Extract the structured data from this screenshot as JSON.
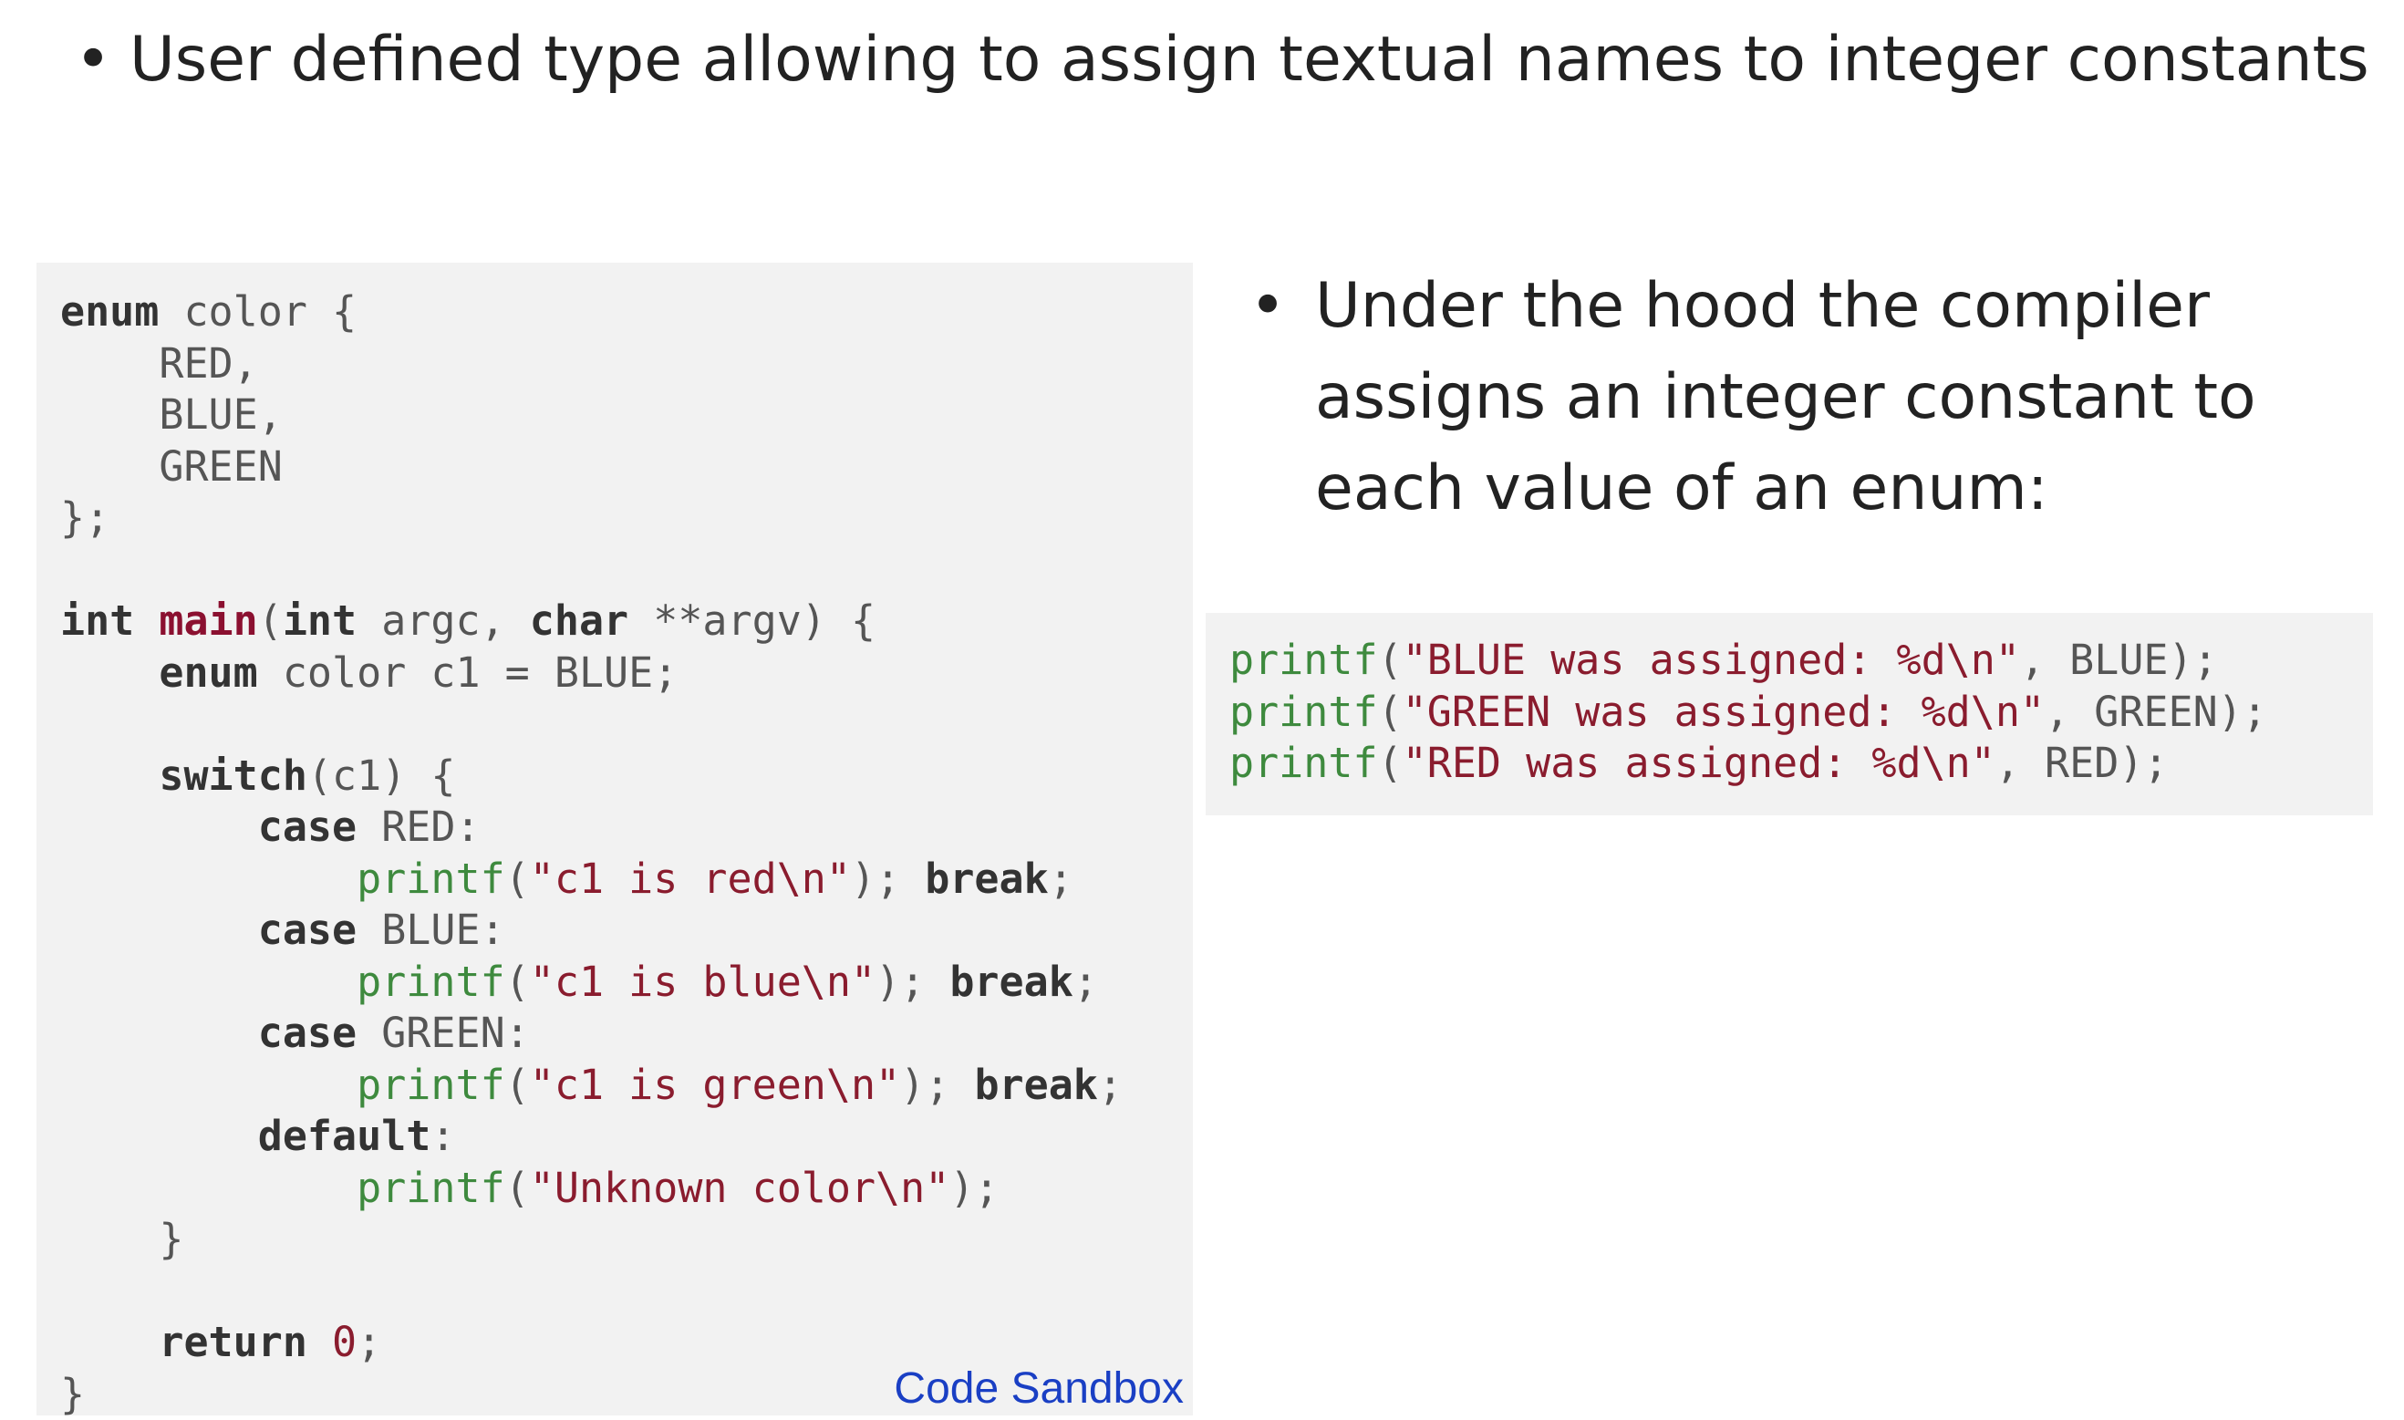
{
  "top_bullet": {
    "text": "User defined type allowing to assign textual names to integer constants"
  },
  "code_sample": {
    "lines": [
      [
        {
          "t": "kw",
          "v": "enum"
        },
        {
          "t": "plain",
          "v": " color {"
        }
      ],
      [
        {
          "t": "plain",
          "v": "    RED,"
        }
      ],
      [
        {
          "t": "plain",
          "v": "    BLUE,"
        }
      ],
      [
        {
          "t": "plain",
          "v": "    GREEN"
        }
      ],
      [
        {
          "t": "plain",
          "v": "};"
        }
      ],
      [
        {
          "t": "plain",
          "v": ""
        }
      ],
      [
        {
          "t": "kt",
          "v": "int"
        },
        {
          "t": "plain",
          "v": " "
        },
        {
          "t": "fn-main",
          "v": "main"
        },
        {
          "t": "plain",
          "v": "("
        },
        {
          "t": "kt",
          "v": "int"
        },
        {
          "t": "plain",
          "v": " argc, "
        },
        {
          "t": "kt",
          "v": "char"
        },
        {
          "t": "plain",
          "v": " **argv) {"
        }
      ],
      [
        {
          "t": "plain",
          "v": "    "
        },
        {
          "t": "kw",
          "v": "enum"
        },
        {
          "t": "plain",
          "v": " color c1 = BLUE;"
        }
      ],
      [
        {
          "t": "plain",
          "v": ""
        }
      ],
      [
        {
          "t": "plain",
          "v": "    "
        },
        {
          "t": "kw",
          "v": "switch"
        },
        {
          "t": "plain",
          "v": "(c1) {"
        }
      ],
      [
        {
          "t": "plain",
          "v": "        "
        },
        {
          "t": "kw",
          "v": "case"
        },
        {
          "t": "plain",
          "v": " RED:"
        }
      ],
      [
        {
          "t": "plain",
          "v": "            "
        },
        {
          "t": "fn",
          "v": "printf"
        },
        {
          "t": "plain",
          "v": "("
        },
        {
          "t": "str",
          "v": "\"c1 is red\\n\""
        },
        {
          "t": "plain",
          "v": "); "
        },
        {
          "t": "kw",
          "v": "break"
        },
        {
          "t": "plain",
          "v": ";"
        }
      ],
      [
        {
          "t": "plain",
          "v": "        "
        },
        {
          "t": "kw",
          "v": "case"
        },
        {
          "t": "plain",
          "v": " BLUE:"
        }
      ],
      [
        {
          "t": "plain",
          "v": "            "
        },
        {
          "t": "fn",
          "v": "printf"
        },
        {
          "t": "plain",
          "v": "("
        },
        {
          "t": "str",
          "v": "\"c1 is blue\\n\""
        },
        {
          "t": "plain",
          "v": "); "
        },
        {
          "t": "kw",
          "v": "break"
        },
        {
          "t": "plain",
          "v": ";"
        }
      ],
      [
        {
          "t": "plain",
          "v": "        "
        },
        {
          "t": "kw",
          "v": "case"
        },
        {
          "t": "plain",
          "v": " GREEN:"
        }
      ],
      [
        {
          "t": "plain",
          "v": "            "
        },
        {
          "t": "fn",
          "v": "printf"
        },
        {
          "t": "plain",
          "v": "("
        },
        {
          "t": "str",
          "v": "\"c1 is green\\n\""
        },
        {
          "t": "plain",
          "v": "); "
        },
        {
          "t": "kw",
          "v": "break"
        },
        {
          "t": "plain",
          "v": ";"
        }
      ],
      [
        {
          "t": "plain",
          "v": "        "
        },
        {
          "t": "kw",
          "v": "default"
        },
        {
          "t": "plain",
          "v": ":"
        }
      ],
      [
        {
          "t": "plain",
          "v": "            "
        },
        {
          "t": "fn",
          "v": "printf"
        },
        {
          "t": "plain",
          "v": "("
        },
        {
          "t": "str",
          "v": "\"Unknown color\\n\""
        },
        {
          "t": "plain",
          "v": ");"
        }
      ],
      [
        {
          "t": "plain",
          "v": "    }"
        }
      ],
      [
        {
          "t": "plain",
          "v": ""
        }
      ],
      [
        {
          "t": "plain",
          "v": "    "
        },
        {
          "t": "kw",
          "v": "return"
        },
        {
          "t": "plain",
          "v": " "
        },
        {
          "t": "num",
          "v": "0"
        },
        {
          "t": "plain",
          "v": ";"
        }
      ],
      [
        {
          "t": "plain",
          "v": "}"
        }
      ]
    ]
  },
  "sandbox_link": {
    "label": "Code Sandbox"
  },
  "right_bullet": {
    "text": "Under the hood the compiler assigns an integer constant to each value of an enum:"
  },
  "printf_sample": {
    "lines": [
      [
        {
          "t": "fn",
          "v": "printf"
        },
        {
          "t": "plain",
          "v": "("
        },
        {
          "t": "str",
          "v": "\"BLUE was assigned: %d\\n\""
        },
        {
          "t": "plain",
          "v": ", BLUE);"
        }
      ],
      [
        {
          "t": "fn",
          "v": "printf"
        },
        {
          "t": "plain",
          "v": "("
        },
        {
          "t": "str",
          "v": "\"GREEN was assigned: %d\\n\""
        },
        {
          "t": "plain",
          "v": ", GREEN);"
        }
      ],
      [
        {
          "t": "fn",
          "v": "printf"
        },
        {
          "t": "plain",
          "v": "("
        },
        {
          "t": "str",
          "v": "\"RED was assigned: %d\\n\""
        },
        {
          "t": "plain",
          "v": ", RED);"
        }
      ]
    ]
  },
  "colors": {
    "code_background": "#f2f2f2",
    "keyword": "#333333",
    "function_name": "#3e8a3e",
    "main_name": "#8b1030",
    "string": "#8a1c2e",
    "link": "#1a3fc4"
  }
}
